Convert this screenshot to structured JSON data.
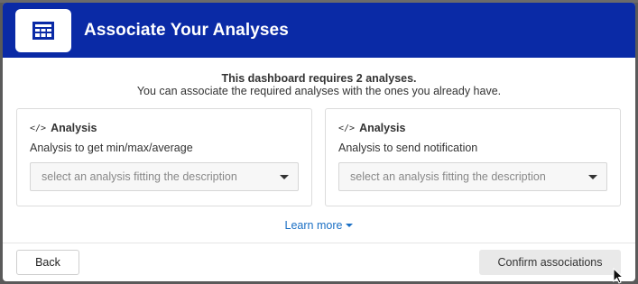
{
  "modal": {
    "title": "Associate Your Analyses",
    "intro_line1": "This dashboard requires 2 analyses.",
    "intro_line2": "You can associate the required analyses with the ones you already have."
  },
  "cards": [
    {
      "icon": "code-icon",
      "heading": "Analysis",
      "description": "Analysis to get min/max/average",
      "select_placeholder": "select an analysis fitting the description"
    },
    {
      "icon": "code-icon",
      "heading": "Analysis",
      "description": "Analysis to send notification",
      "select_placeholder": "select an analysis fitting the description"
    }
  ],
  "learn_more": "Learn more",
  "footer": {
    "back_label": "Back",
    "confirm_label": "Confirm associations"
  },
  "colors": {
    "header_bg": "#0a2aa6",
    "link": "#1a6fc4"
  }
}
